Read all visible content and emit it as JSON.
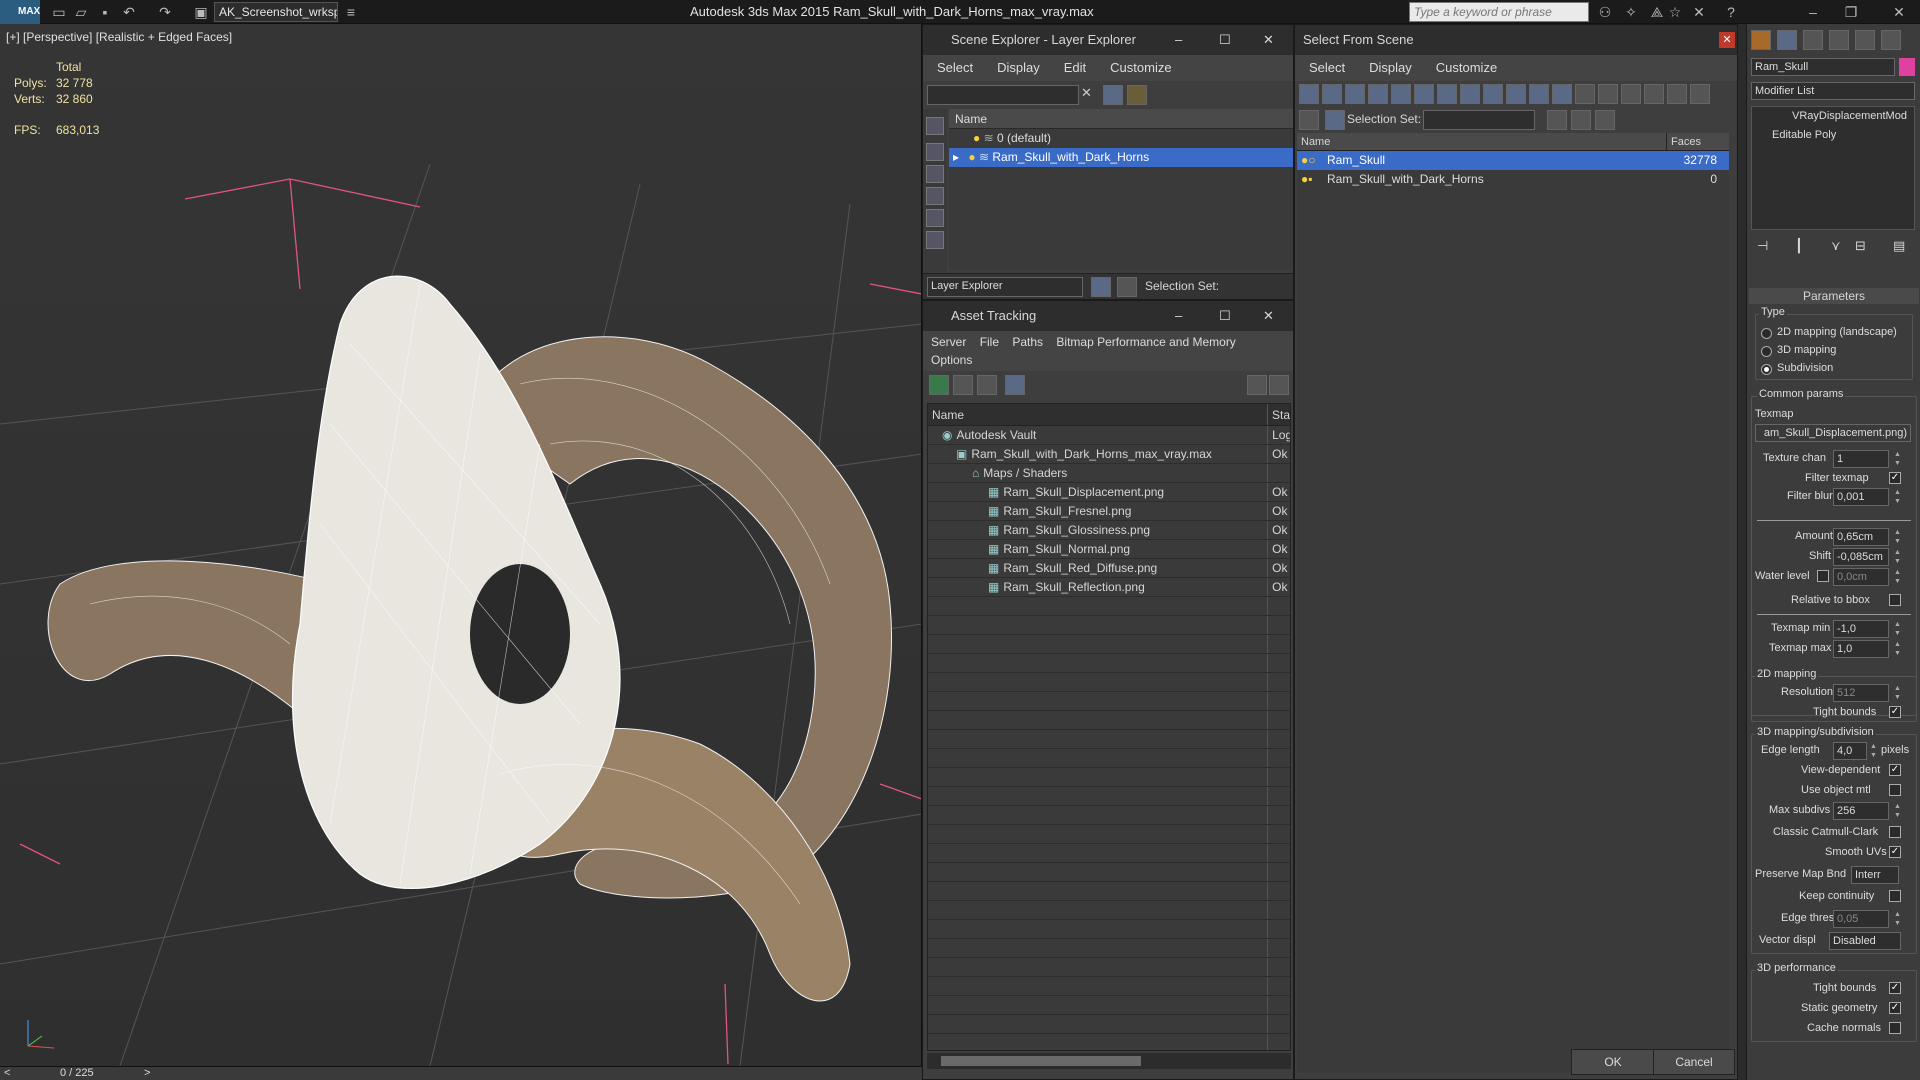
{
  "app": {
    "title": "Autodesk 3ds Max  2015     Ram_Skull_with_Dark_Horns_max_vray.max",
    "workspace": "AK_Screenshot_wrksp",
    "search_placeholder": "Type a keyword or phrase",
    "logo": "MAX"
  },
  "viewport": {
    "label": "[+] [Perspective] [Realistic + Edged Faces]",
    "stats_total": "Total",
    "polys_label": "Polys:",
    "polys": "32 778",
    "verts_label": "Verts:",
    "verts": "32 860",
    "fps_label": "FPS:",
    "fps": "683,013",
    "timeline": "0 / 225"
  },
  "scene_explorer": {
    "title": "Scene Explorer - Layer Explorer",
    "menus": [
      "Select",
      "Display",
      "Edit",
      "Customize"
    ],
    "col_name": "Name",
    "rows": [
      "0 (default)",
      "Ram_Skull_with_Dark_Horns"
    ],
    "footer_left": "Layer Explorer",
    "footer_right": "Selection Set:"
  },
  "asset_tracking": {
    "title": "Asset Tracking",
    "menus": [
      "Server",
      "File",
      "Paths",
      "Bitmap Performance and Memory"
    ],
    "menu2": "Options",
    "col_name": "Name",
    "col_status": "Stat",
    "rows": [
      {
        "name": "Autodesk Vault",
        "status": "Log"
      },
      {
        "name": "Ram_Skull_with_Dark_Horns_max_vray.max",
        "status": "Ok"
      },
      {
        "name": "Maps / Shaders",
        "status": ""
      },
      {
        "name": "Ram_Skull_Displacement.png",
        "status": "Ok"
      },
      {
        "name": "Ram_Skull_Fresnel.png",
        "status": "Ok"
      },
      {
        "name": "Ram_Skull_Glossiness.png",
        "status": "Ok"
      },
      {
        "name": "Ram_Skull_Normal.png",
        "status": "Ok"
      },
      {
        "name": "Ram_Skull_Red_Diffuse.png",
        "status": "Ok"
      },
      {
        "name": "Ram_Skull_Reflection.png",
        "status": "Ok"
      }
    ]
  },
  "select_from_scene": {
    "title": "Select From Scene",
    "menus": [
      "Select",
      "Display",
      "Customize"
    ],
    "selection_set": "Selection Set:",
    "col_name": "Name",
    "col_faces": "Faces",
    "rows": [
      {
        "name": "Ram_Skull",
        "faces": "32778"
      },
      {
        "name": "Ram_Skull_with_Dark_Horns",
        "faces": "0"
      }
    ],
    "ok": "OK",
    "cancel": "Cancel"
  },
  "command_panel": {
    "object_name": "Ram_Skull",
    "modifier_list": "Modifier List",
    "stack": [
      "VRayDisplacementMod",
      "Editable Poly"
    ],
    "params_title": "Parameters",
    "type_label": "Type",
    "type_options": [
      "2D mapping (landscape)",
      "3D mapping",
      "Subdivision"
    ],
    "common_params": "Common params",
    "texmap_label": "Texmap",
    "texmap": "am_Skull_Displacement.png)",
    "texture_chan_label": "Texture chan",
    "texture_chan": "1",
    "filter_texmap": "Filter texmap",
    "filter_blur_label": "Filter blur",
    "filter_blur": "0,001",
    "amount_label": "Amount",
    "amount": "0,65cm",
    "shift_label": "Shift",
    "shift": "-0,085cm",
    "water_level_label": "Water level",
    "water_level": "0,0cm",
    "relative_bbox": "Relative to bbox",
    "texmap_min_label": "Texmap min",
    "texmap_min": "-1,0",
    "texmap_max_label": "Texmap max",
    "texmap_max": "1,0",
    "mapping2d": "2D mapping",
    "resolution_label": "Resolution",
    "resolution": "512",
    "tight_bounds": "Tight bounds",
    "mapping3d": "3D mapping/subdivision",
    "edge_length_label": "Edge length",
    "edge_length": "4,0",
    "pixels": "pixels",
    "view_dependent": "View-dependent",
    "use_object_mtl": "Use object mtl",
    "max_subdivs_label": "Max subdivs",
    "max_subdivs": "256",
    "classic_cc": "Classic Catmull-Clark",
    "smooth_uvs": "Smooth UVs",
    "preserve_label": "Preserve Map Bnd",
    "preserve": "Interr",
    "keep_continuity": "Keep continuity",
    "edge_thresh_label": "Edge thresh",
    "edge_thresh": "0,05",
    "vector_label": "Vector displ",
    "vector": "Disabled",
    "perf3d": "3D performance",
    "tight_bounds2": "Tight bounds",
    "static_geometry": "Static geometry",
    "cache_normals": "Cache normals"
  }
}
